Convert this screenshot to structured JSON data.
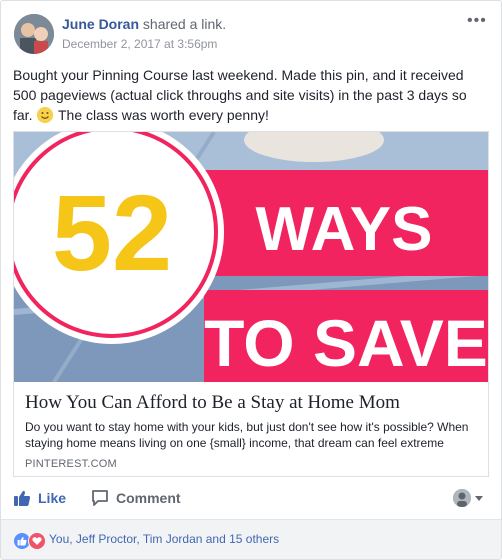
{
  "post": {
    "author": "June Doran",
    "action": " shared a link.",
    "date": "December 2, 2017 at 3:56pm",
    "more": "•••",
    "text_part1": "Bought your Pinning Course last weekend. Made this pin, and it received 500 pageviews (actual click throughs and site visits) in the past 3 days so far.",
    "text_part2": " The class was worth every penny!"
  },
  "link": {
    "image_number": "52",
    "image_line1": "WAYS",
    "image_line2": "TO SAVE",
    "title": "How You Can Afford to Be a Stay at Home Mom",
    "description": "Do you want to stay home with your kids, but just don't see how it's possible? When staying home means living on one {small} income, that dream can feel extreme",
    "domain": "PINTEREST.COM"
  },
  "actions": {
    "like": "Like",
    "comment": "Comment"
  },
  "reactions": {
    "text": "You, Jeff Proctor, Tim Jordan and 15 others"
  },
  "colors": {
    "accent": "#4267b2",
    "name_link": "#365899",
    "pin_pink": "#f2245f",
    "pin_yellow": "#f5c518"
  }
}
